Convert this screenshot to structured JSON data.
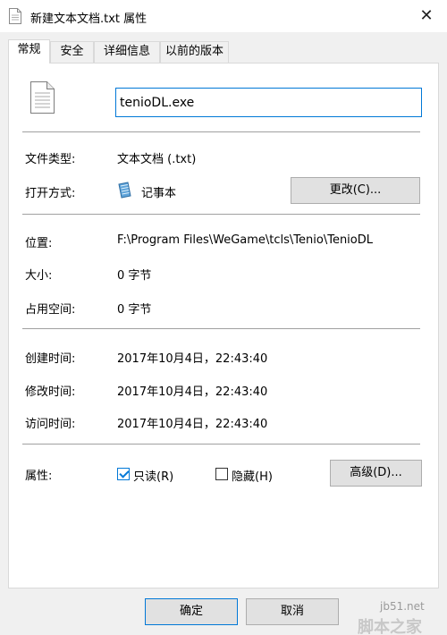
{
  "window": {
    "title": "新建文本文档.txt 属性",
    "close_glyph": "✕"
  },
  "tabs": [
    {
      "label": "常规"
    },
    {
      "label": "安全"
    },
    {
      "label": "详细信息"
    },
    {
      "label": "以前的版本"
    }
  ],
  "general": {
    "file_name": "tenioDL.exe",
    "file_type_label": "文件类型:",
    "file_type_value": "文本文档 (.txt)",
    "open_with_label": "打开方式:",
    "open_with_value": "记事本",
    "change_button": "更改(C)...",
    "location_label": "位置:",
    "location_value": "F:\\Program Files\\WeGame\\tcls\\Tenio\\TenioDL",
    "size_label": "大小:",
    "size_value": "0 字节",
    "size_on_disk_label": "占用空间:",
    "size_on_disk_value": "0 字节",
    "created_label": "创建时间:",
    "created_value": "2017年10月4日，22:43:40",
    "modified_label": "修改时间:",
    "modified_value": "2017年10月4日，22:43:40",
    "accessed_label": "访问时间:",
    "accessed_value": "2017年10月4日，22:43:40",
    "attributes_label": "属性:",
    "readonly_label": "只读(R)",
    "readonly_checked": true,
    "hidden_label": "隐藏(H)",
    "hidden_checked": false,
    "advanced_button": "高级(D)..."
  },
  "footer": {
    "ok_button": "确定",
    "cancel_button": "取消"
  },
  "watermark": {
    "line1": "jb51.net",
    "line2": "脚本之家"
  },
  "colors": {
    "accent": "#0078d7"
  }
}
